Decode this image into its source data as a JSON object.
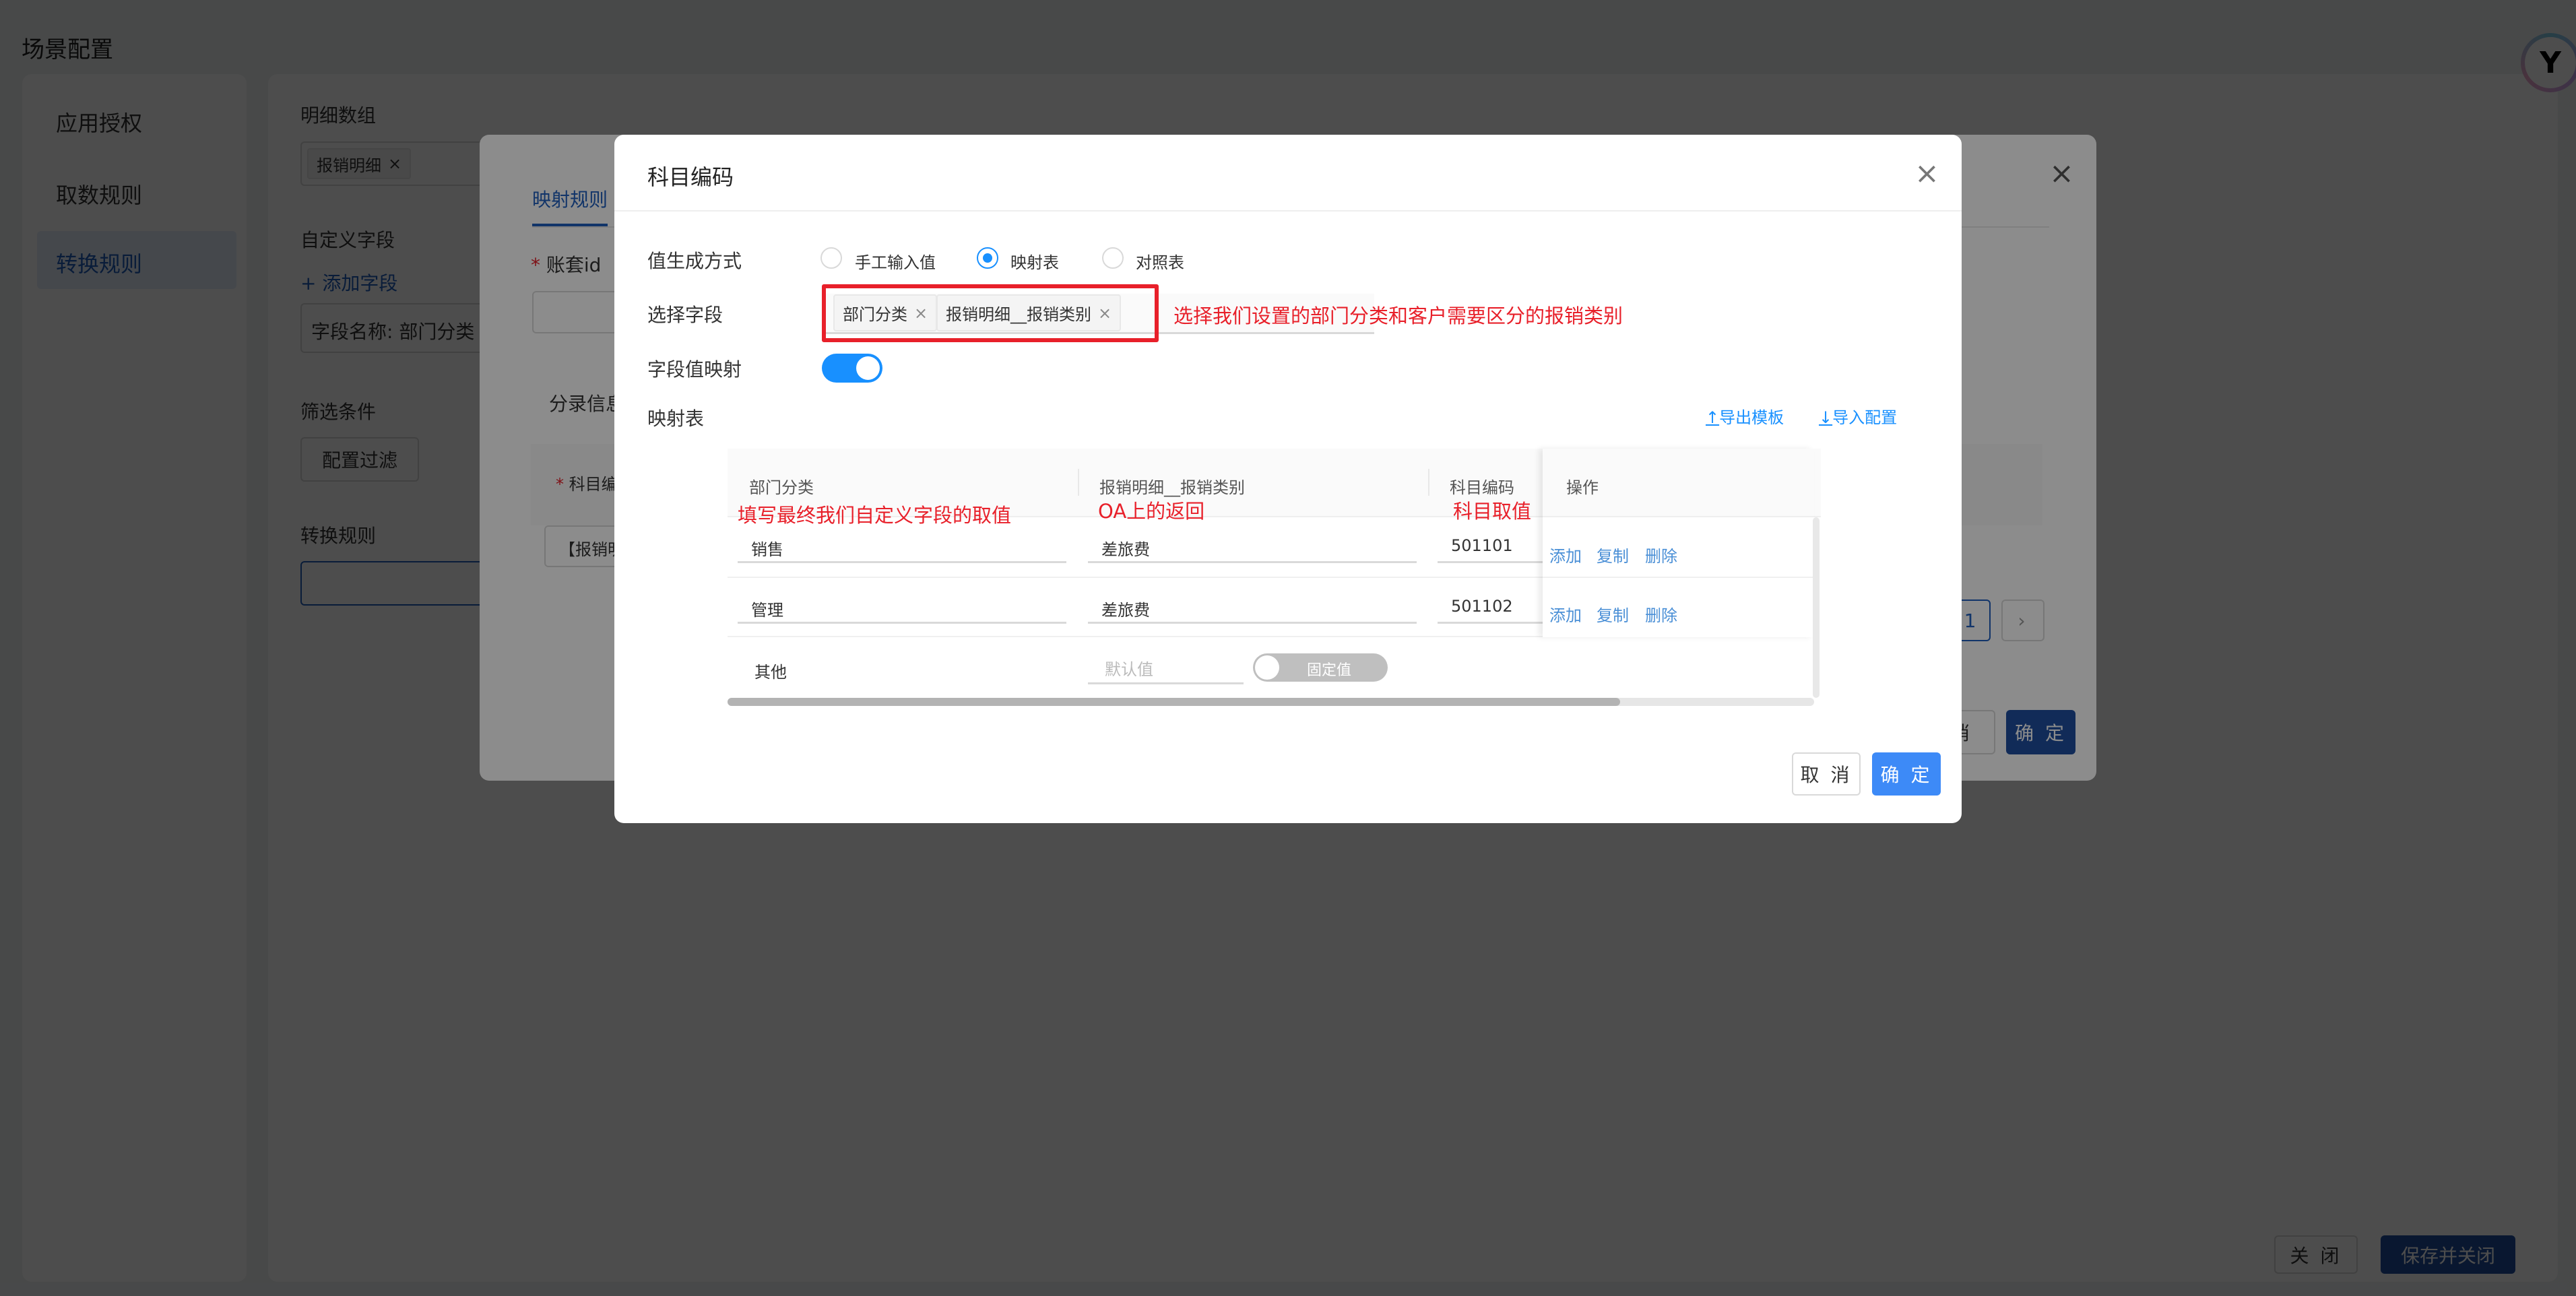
{
  "page": {
    "title": "场景配置",
    "sidebar": [
      {
        "label": "应用授权",
        "active": false
      },
      {
        "label": "取数规则",
        "active": false
      },
      {
        "label": "转换规则",
        "active": true
      }
    ],
    "main": {
      "detail_array_label": "明细数组",
      "detail_array_tag": "报销明细",
      "custom_field_label": "自定义字段",
      "add_field_link": "+ 添加字段",
      "field_name_value": "字段名称: 部门分类",
      "filter_label": "筛选条件",
      "filter_button": "配置过滤",
      "convert_rule_label": "转换规则"
    },
    "footer": {
      "close": "关 闭",
      "save_close": "保存并关闭"
    }
  },
  "mapping_dialog": {
    "tab": "映射规则",
    "account_id_label": "账套id",
    "entry_info_label": "分录信息",
    "table_header_subject": "科目编",
    "row_value": "【报销明",
    "page_current": "1",
    "cancel": "消",
    "confirm": "确 定"
  },
  "subject_dialog": {
    "title": "科目编码",
    "value_mode_label": "值生成方式",
    "value_mode_options": [
      {
        "label": "手工输入值",
        "selected": false
      },
      {
        "label": "映射表",
        "selected": true
      },
      {
        "label": "对照表",
        "selected": false
      }
    ],
    "select_field_label": "选择字段",
    "selected_fields": [
      "部门分类",
      "报销明细__报销类别"
    ],
    "select_field_annotation": "选择我们设置的部门分类和客户需要区分的报销类别",
    "field_mapping_label": "字段值映射",
    "field_mapping_enabled": true,
    "mapping_table_label": "映射表",
    "export_template": "导出模板",
    "import_config": "导入配置",
    "table": {
      "columns": [
        "部门分类",
        "报销明细__报销类别",
        "科目编码",
        "操作"
      ],
      "annotations": [
        "填写最终我们自定义字段的取值",
        "OA上的返回",
        "科目取值"
      ],
      "rows": [
        {
          "dept": "销售",
          "type": "差旅费",
          "code": "501101",
          "actions": [
            "添加",
            "复制",
            "删除"
          ]
        },
        {
          "dept": "管理",
          "type": "差旅费",
          "code": "501102",
          "actions": [
            "添加",
            "复制",
            "删除"
          ]
        }
      ],
      "other_row": {
        "label": "其他",
        "placeholder": "默认值",
        "toggle_label": "固定值",
        "toggle_on": false
      }
    },
    "cancel": "取 消",
    "confirm": "确 定"
  },
  "colors": {
    "accent": "#1890ff",
    "annotation": "#e8202a",
    "primary_button": "#3d8af7"
  }
}
